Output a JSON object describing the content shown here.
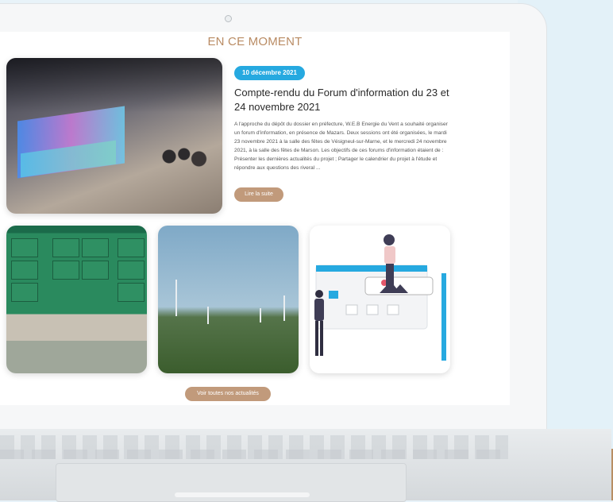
{
  "section": {
    "title": "EN CE MOMENT"
  },
  "featured_post": {
    "date": "10 décembre 2021",
    "title": "Compte-rendu du Forum d'information du 23 et 24 novembre 2021",
    "excerpt": "A l'approche du dépôt du dossier en préfecture, W.E.B Energie du Vent a souhaité organiser un forum d'information, en présence de Mazars.   Deux sessions ont été organisées, le mardi 23 novembre 2021 à la salle des fêtes de Vésigneul-sur-Marne, et le mercredi 24 novembre 2021, à la salle des fêtes de Marson.   Les objectifs de ces forums d'information étaient de : Présenter les dernières actualités du projet ; Partager le calendrier du projet à l'étude et répondre aux questions des riveral ...",
    "read_more_label": "Lire la suite"
  },
  "more_button_label": "Voir toutes nos actualités",
  "colors": {
    "accent": "#26a9e0",
    "brand_brown": "#c19a7b",
    "title_brown": "#b98b63"
  }
}
